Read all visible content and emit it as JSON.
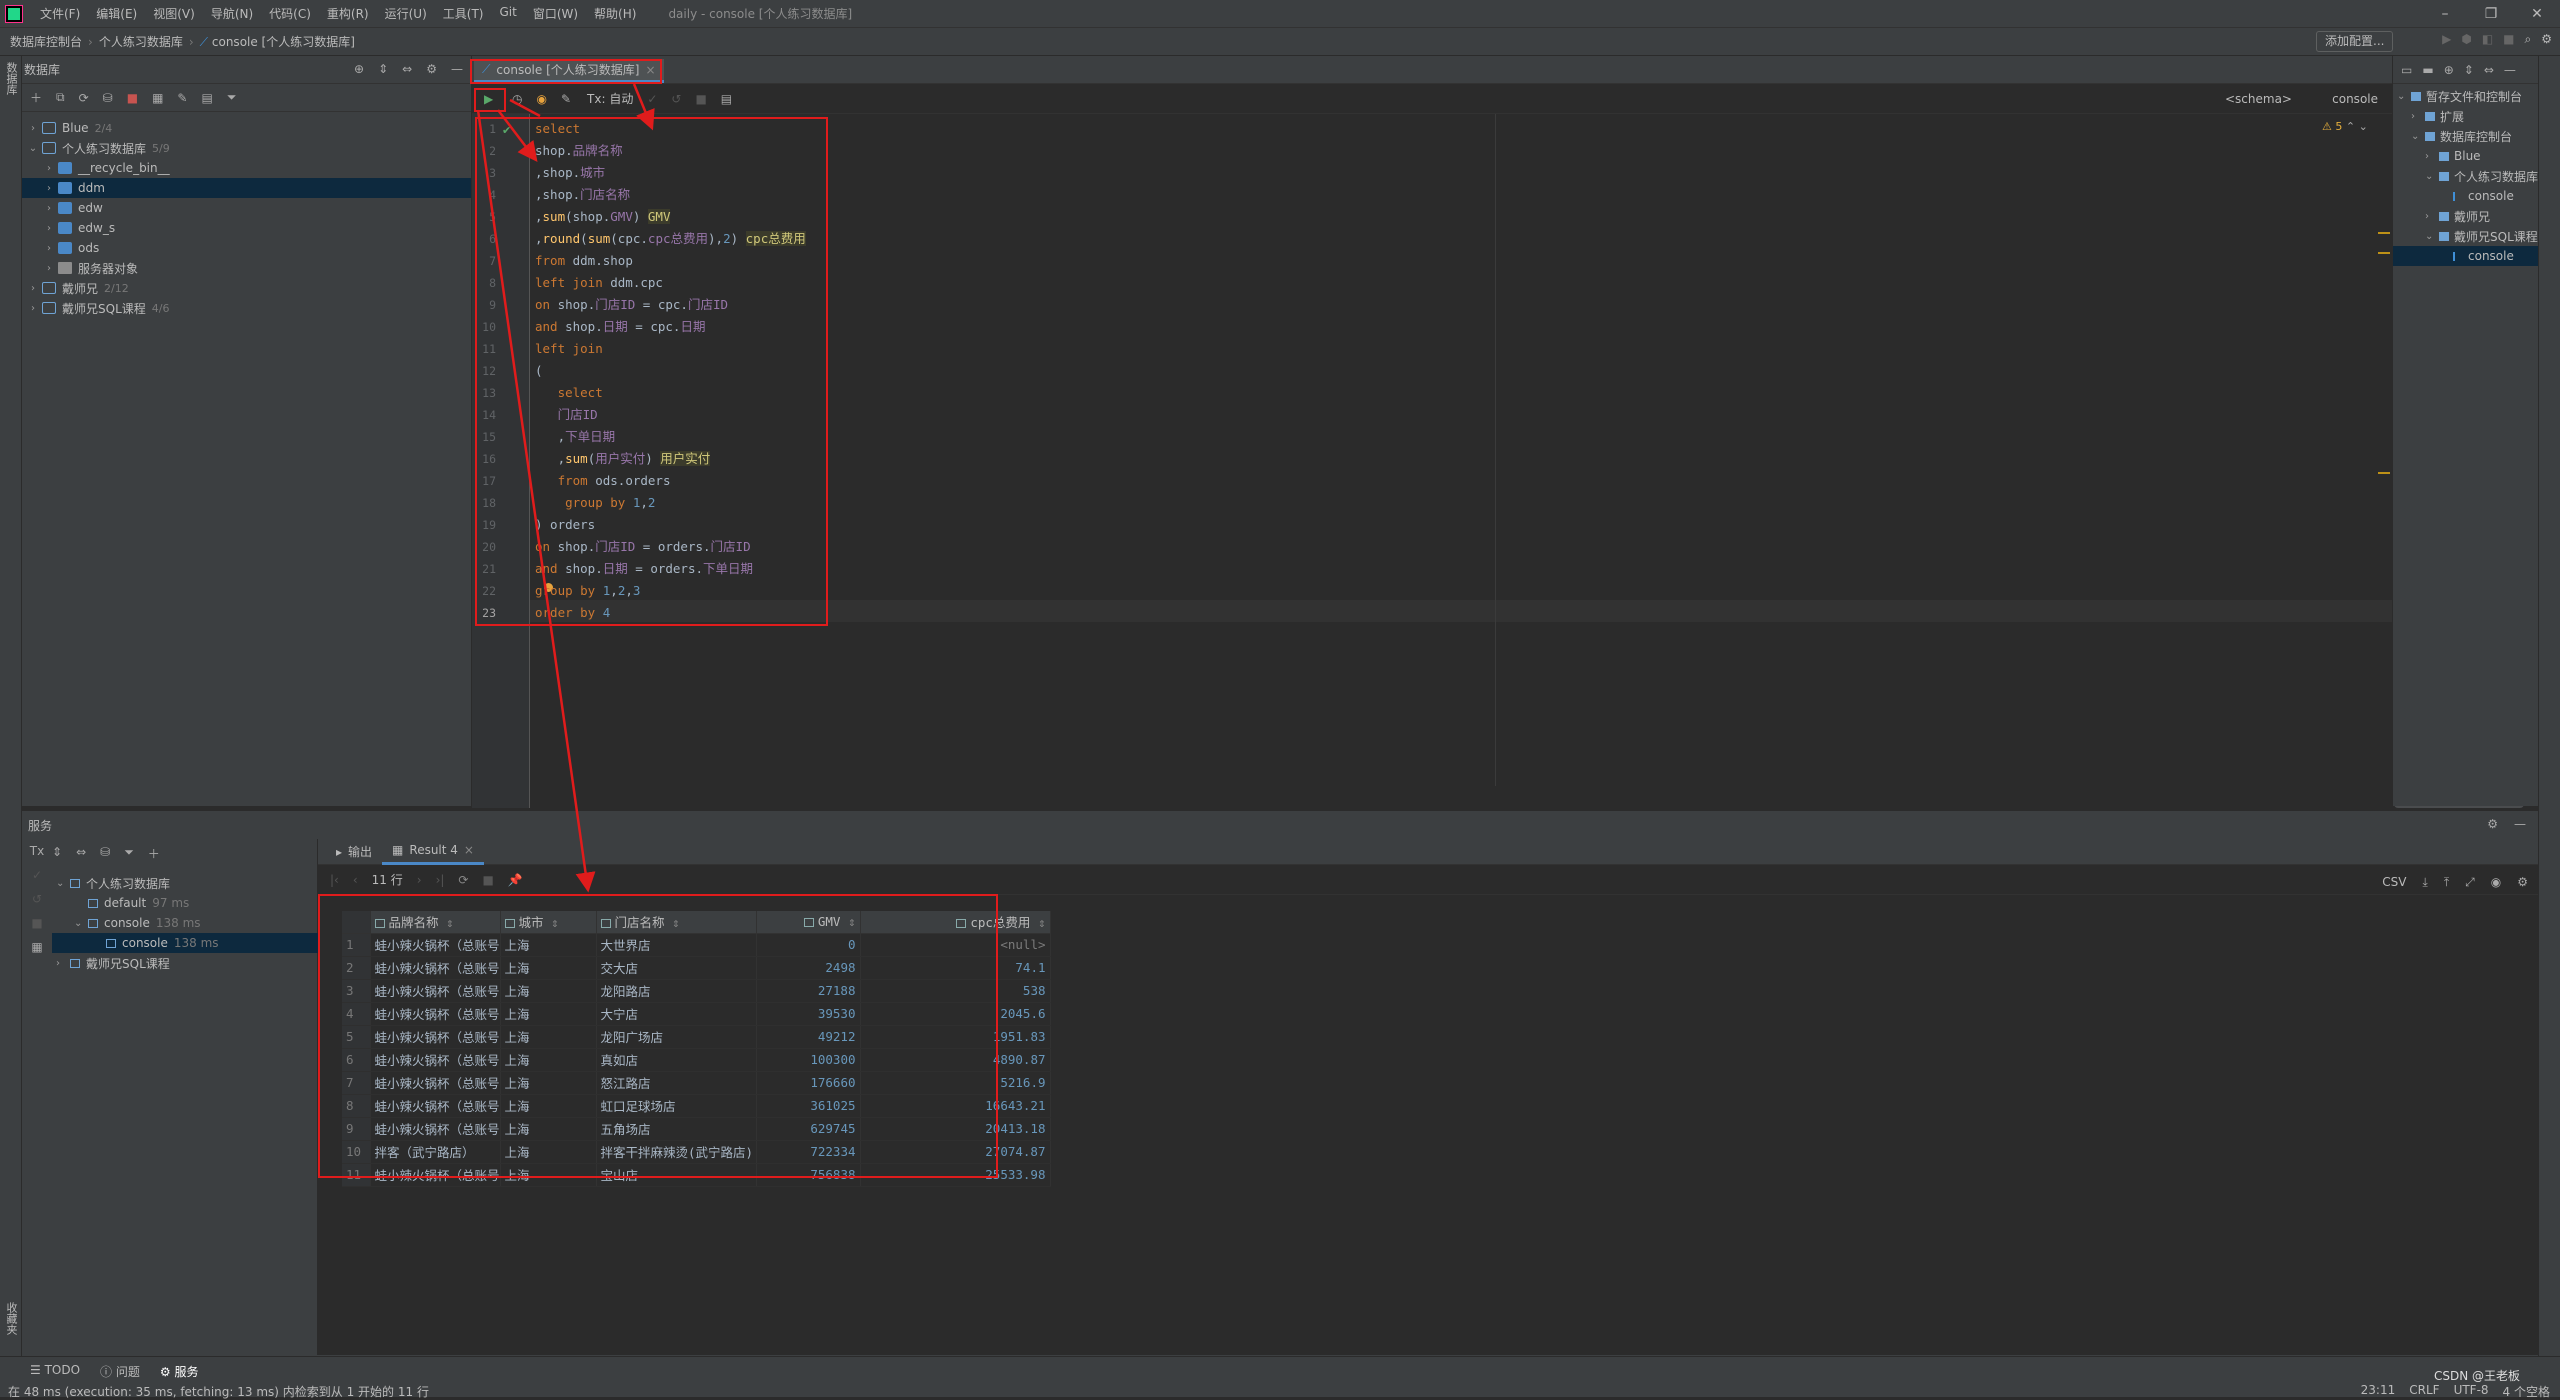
{
  "menu": {
    "items": [
      "文件(F)",
      "编辑(E)",
      "视图(V)",
      "导航(N)",
      "代码(C)",
      "重构(R)",
      "运行(U)",
      "工具(T)",
      "Git",
      "窗口(W)",
      "帮助(H)"
    ],
    "window_title": "daily - console [个人练习数据库]"
  },
  "nav": {
    "crumbs": [
      "数据库控制台",
      "个人练习数据库",
      "console [个人练习数据库]"
    ],
    "add_config": "添加配置..."
  },
  "left_strip": {
    "tab1": "数据库",
    "tab2": "收藏夹"
  },
  "db_panel": {
    "title": "数据库",
    "tree": [
      {
        "label": "Blue",
        "count": "2/4",
        "level": 0,
        "arrow": "›",
        "icon": "db"
      },
      {
        "label": "个人练习数据库",
        "count": "5/9",
        "level": 0,
        "arrow": "⌄",
        "icon": "db"
      },
      {
        "label": "__recycle_bin__",
        "count": "",
        "level": 1,
        "arrow": "›",
        "icon": "schema"
      },
      {
        "label": "ddm",
        "count": "",
        "level": 1,
        "arrow": "›",
        "icon": "schema"
      },
      {
        "label": "edw",
        "count": "",
        "level": 1,
        "arrow": "›",
        "icon": "schema"
      },
      {
        "label": "edw_s",
        "count": "",
        "level": 1,
        "arrow": "›",
        "icon": "schema"
      },
      {
        "label": "ods",
        "count": "",
        "level": 1,
        "arrow": "›",
        "icon": "schema"
      },
      {
        "label": "服务器对象",
        "count": "",
        "level": 1,
        "arrow": "›",
        "icon": "folder"
      },
      {
        "label": "戴师兄",
        "count": "2/12",
        "level": 0,
        "arrow": "›",
        "icon": "db"
      },
      {
        "label": "戴师兄SQL课程",
        "count": "4/6",
        "level": 0,
        "arrow": "›",
        "icon": "db"
      }
    ],
    "selected_index": 3
  },
  "editor": {
    "tab_label": "console [个人练习数据库]",
    "tx_label": "Tx: 自动",
    "schema_label": "<schema>",
    "console_label": "console",
    "warning_count": "5",
    "line_numbers": [
      "1",
      "2",
      "3",
      "4",
      "5",
      "6",
      "7",
      "8",
      "9",
      "10",
      "11",
      "12",
      "13",
      "14",
      "15",
      "16",
      "17",
      "18",
      "19",
      "20",
      "21",
      "22",
      "23"
    ]
  },
  "project_panel": {
    "tree": [
      {
        "label": "暂存文件和控制台",
        "level": 0,
        "arrow": "⌄"
      },
      {
        "label": "扩展",
        "level": 1,
        "arrow": "›"
      },
      {
        "label": "数据库控制台",
        "level": 1,
        "arrow": "⌄"
      },
      {
        "label": "Blue",
        "level": 2,
        "arrow": "›"
      },
      {
        "label": "个人练习数据库",
        "level": 2,
        "arrow": "⌄"
      },
      {
        "label": "console",
        "level": 3,
        "arrow": ""
      },
      {
        "label": "戴师兄",
        "level": 2,
        "arrow": "›"
      },
      {
        "label": "戴师兄SQL课程",
        "level": 2,
        "arrow": "⌄"
      },
      {
        "label": "console",
        "level": 3,
        "arrow": ""
      }
    ],
    "selected_index": 8
  },
  "services": {
    "title": "服务",
    "tree": [
      {
        "label": "个人练习数据库",
        "ms": "",
        "level": 0,
        "arrow": "⌄"
      },
      {
        "label": "default",
        "ms": "97 ms",
        "level": 1,
        "arrow": ""
      },
      {
        "label": "console",
        "ms": "138 ms",
        "level": 1,
        "arrow": "⌄"
      },
      {
        "label": "console",
        "ms": "138 ms",
        "level": 2,
        "arrow": ""
      },
      {
        "label": "戴师兄SQL课程",
        "ms": "",
        "level": 0,
        "arrow": "›"
      }
    ],
    "selected_index": 3
  },
  "results": {
    "tab_output": "输出",
    "tab_result": "Result 4",
    "rows_label": "11 行",
    "export_format": "CSV",
    "columns": [
      "品牌名称",
      "城市",
      "门店名称",
      "GMV",
      "cpc总费用"
    ],
    "rows": [
      [
        "1",
        "蛙小辣火锅杯（总账号）",
        "上海",
        "大世界店",
        "0",
        "<null>"
      ],
      [
        "2",
        "蛙小辣火锅杯（总账号）",
        "上海",
        "交大店",
        "2498",
        "74.1"
      ],
      [
        "3",
        "蛙小辣火锅杯（总账号）",
        "上海",
        "龙阳路店",
        "27188",
        "538"
      ],
      [
        "4",
        "蛙小辣火锅杯（总账号）",
        "上海",
        "大宁店",
        "39530",
        "2045.6"
      ],
      [
        "5",
        "蛙小辣火锅杯（总账号）",
        "上海",
        "龙阳广场店",
        "49212",
        "1951.83"
      ],
      [
        "6",
        "蛙小辣火锅杯（总账号）",
        "上海",
        "真如店",
        "100300",
        "4890.87"
      ],
      [
        "7",
        "蛙小辣火锅杯（总账号）",
        "上海",
        "怒江路店",
        "176660",
        "5216.9"
      ],
      [
        "8",
        "蛙小辣火锅杯（总账号）",
        "上海",
        "虹口足球场店",
        "361025",
        "16643.21"
      ],
      [
        "9",
        "蛙小辣火锅杯（总账号）",
        "上海",
        "五角场店",
        "629745",
        "20413.18"
      ],
      [
        "10",
        "拌客（武宁路店）",
        "上海",
        "拌客干拌麻辣烫(武宁路店)",
        "722334",
        "27074.87"
      ],
      [
        "11",
        "蛙小辣火锅杯（总账号）",
        "上海",
        "宝山店",
        "756838",
        "25533.98"
      ]
    ]
  },
  "status": {
    "tools": [
      "TODO",
      "问题",
      "服务"
    ],
    "message": "在 48 ms (execution: 35 ms, fetching: 13 ms) 内检索到从 1 开始的 11 行",
    "position": "23:11",
    "line_sep": "CRLF",
    "encoding": "UTF-8",
    "indent": "4 个空格",
    "watermark": "CSDN @王老板"
  },
  "colors": {
    "annotation": "#e01c1c",
    "accent": "#4a88c7",
    "keyword": "#cc7832"
  }
}
